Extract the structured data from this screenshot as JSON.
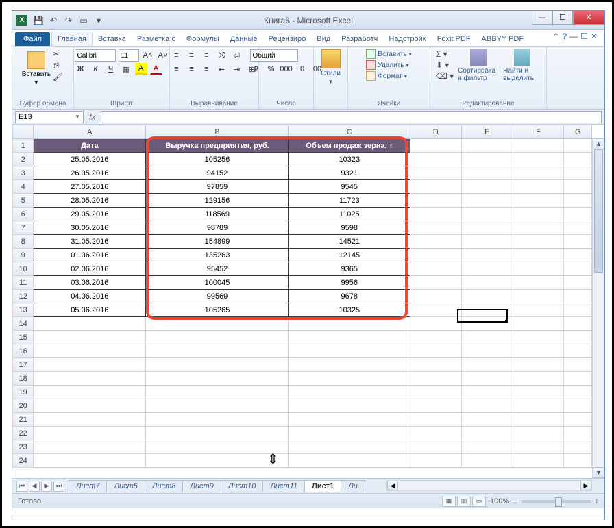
{
  "window": {
    "title": "Книга6 - Microsoft Excel"
  },
  "qat_icons": [
    "save-icon",
    "undo-icon",
    "redo-icon",
    "print-icon",
    "down-icon"
  ],
  "tabs": {
    "file": "Файл",
    "items": [
      "Главная",
      "Вставка",
      "Разметка с",
      "Формулы",
      "Данные",
      "Рецензиро",
      "Вид",
      "Разработч",
      "Надстройк",
      "Foxit PDF",
      "ABBYY PDF"
    ],
    "active_index": 0
  },
  "ribbon": {
    "clipboard": {
      "label": "Буфер обмена",
      "paste": "Вставить"
    },
    "font": {
      "label": "Шрифт",
      "name": "Calibri",
      "size": "11"
    },
    "alignment": {
      "label": "Выравнивание"
    },
    "number": {
      "label": "Число",
      "format": "Общий"
    },
    "styles": {
      "label": "Стили"
    },
    "cells": {
      "label": "Ячейки",
      "insert": "Вставить",
      "delete": "Удалить",
      "format": "Формат"
    },
    "editing": {
      "label": "Редактирование",
      "sort": "Сортировка и фильтр",
      "find": "Найти и выделить"
    }
  },
  "namebox": "E13",
  "columns": [
    "A",
    "B",
    "C",
    "D",
    "E",
    "F",
    "G"
  ],
  "headers": {
    "A": "Дата",
    "B": "Выручка предприятия, руб.",
    "C": "Объем продаж зерна, т"
  },
  "rows": [
    {
      "n": "2",
      "A": "25.05.2016",
      "B": "105256",
      "C": "10323"
    },
    {
      "n": "3",
      "A": "26.05.2016",
      "B": "94152",
      "C": "9321"
    },
    {
      "n": "4",
      "A": "27.05.2016",
      "B": "97859",
      "C": "9545"
    },
    {
      "n": "5",
      "A": "28.05.2016",
      "B": "129156",
      "C": "11723"
    },
    {
      "n": "6",
      "A": "29.05.2016",
      "B": "118569",
      "C": "11025"
    },
    {
      "n": "7",
      "A": "30.05.2016",
      "B": "98789",
      "C": "9598"
    },
    {
      "n": "8",
      "A": "31.05.2016",
      "B": "154899",
      "C": "14521"
    },
    {
      "n": "9",
      "A": "01.06.2016",
      "B": "135263",
      "C": "12145"
    },
    {
      "n": "10",
      "A": "02.06.2016",
      "B": "95452",
      "C": "9365"
    },
    {
      "n": "11",
      "A": "03.06.2016",
      "B": "100045",
      "C": "9956"
    },
    {
      "n": "12",
      "A": "04.06.2016",
      "B": "99569",
      "C": "9678"
    },
    {
      "n": "13",
      "A": "05.06.2016",
      "B": "105265",
      "C": "10325"
    }
  ],
  "empty_rows": [
    "14",
    "15",
    "16",
    "17",
    "18",
    "19",
    "20",
    "21",
    "22",
    "23",
    "24"
  ],
  "sheet_tabs": [
    "Лист7",
    "Лист5",
    "Лист8",
    "Лист9",
    "Лист10",
    "Лист11",
    "Лист1",
    "Ли"
  ],
  "sheet_active_index": 6,
  "status": {
    "ready": "Готово",
    "zoom": "100%"
  },
  "selected_cell": "E13"
}
